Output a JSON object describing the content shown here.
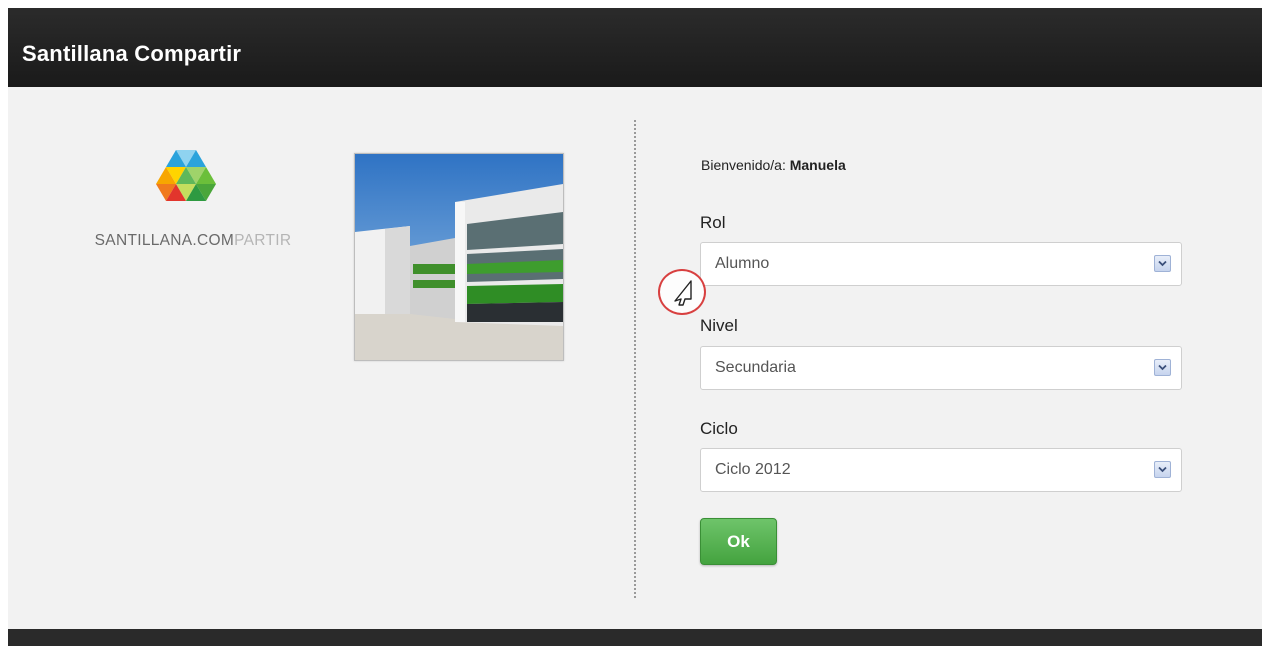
{
  "app": {
    "title": "Santillana Compartir"
  },
  "logo": {
    "text_dark": "SANTILLANA.COM",
    "text_light": "PARTIR"
  },
  "welcome": {
    "prefix": "Bienvenido/a: ",
    "user_name": "Manuela"
  },
  "form": {
    "rol": {
      "label": "Rol",
      "value": "Alumno"
    },
    "nivel": {
      "label": "Nivel",
      "value": "Secundaria"
    },
    "ciclo": {
      "label": "Ciclo",
      "value": "Ciclo 2012"
    },
    "submit_label": "Ok"
  },
  "icons": {
    "select_arrow": "chevron-down-icon",
    "cursor": "pointer-cursor-icon"
  },
  "colors": {
    "header_bg": "#222222",
    "ok_button": "#4caf50",
    "cursor_highlight": "#d84040",
    "logo_blue": "#2aa3dc",
    "logo_green": "#6bbf3a",
    "logo_orange": "#f07a1c",
    "logo_red": "#e2352c"
  }
}
